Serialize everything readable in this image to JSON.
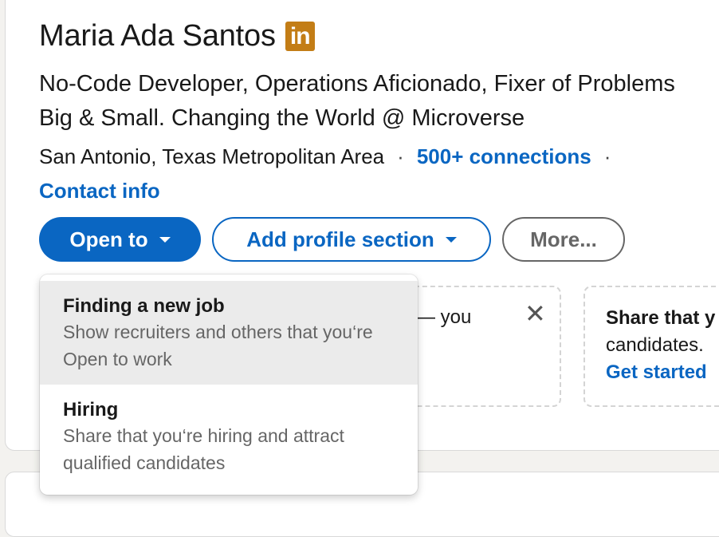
{
  "profile": {
    "name": "Maria Ada Santos",
    "badge": "in",
    "headline": "No-Code Developer, Operations Aficionado, Fixer of Problems Big & Small. Changing the World @ Microverse",
    "location": "San Antonio, Texas Metropolitan Area",
    "separator": "·",
    "connections": "500+ connections",
    "contact_info": "Contact info"
  },
  "actions": {
    "open_to": "Open to",
    "add_section": "Add profile section",
    "more": "More..."
  },
  "suggestions": {
    "card1_text": "— you",
    "close": "✕",
    "card2_title": "Share that y",
    "card2_sub": "candidates.",
    "card2_link": "Get started"
  },
  "dropdown": {
    "items": [
      {
        "title": "Finding a new job",
        "desc": "Show recruiters and others that you‘re Open to work"
      },
      {
        "title": "Hiring",
        "desc": "Share that you‘re hiring and attract qualified candidates"
      }
    ]
  },
  "colors": {
    "brand_blue": "#0a66c2",
    "badge_gold": "#c37d16"
  }
}
